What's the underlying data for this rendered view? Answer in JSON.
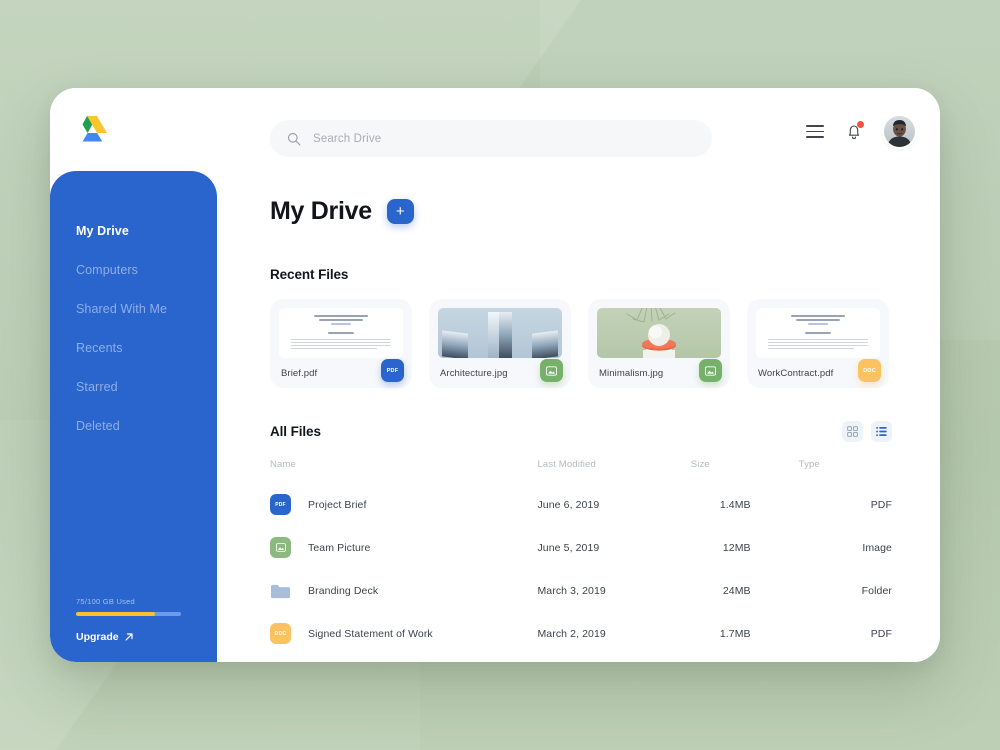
{
  "colors": {
    "page_background": "#b9ccb3",
    "sidebar": "#2a64cd",
    "accent": "#2a64cd",
    "storage_fill": "#fbc02d",
    "storage_track": "#6c9bec",
    "badge_pdf": "#2a64cd",
    "badge_image": "#76b06a",
    "badge_doc": "#fbc262",
    "notification_dot": "#f4513a"
  },
  "topbar": {
    "logo": "google-drive-logo",
    "search": {
      "placeholder": "Search Drive",
      "value": ""
    },
    "menu_icon": "hamburger-menu-icon",
    "bell_icon": "notification-bell-icon",
    "avatar": "user-avatar"
  },
  "sidebar": {
    "items": [
      {
        "label": "My Drive",
        "active": true
      },
      {
        "label": "Computers",
        "active": false
      },
      {
        "label": "Shared With Me",
        "active": false
      },
      {
        "label": "Recents",
        "active": false
      },
      {
        "label": "Starred",
        "active": false
      },
      {
        "label": "Deleted",
        "active": false
      }
    ],
    "storage": {
      "label": "75/100 GB Used",
      "percent": 75,
      "used_gb": 75,
      "total_gb": 100
    },
    "upgrade": {
      "label": "Upgrade",
      "icon": "arrow-up-right-icon"
    }
  },
  "main": {
    "page_title": "My Drive",
    "add_button": "+",
    "recent_section_title": "Recent Files",
    "recent_files": [
      {
        "name": "Brief.pdf",
        "badge": "PDF",
        "badge_type": "pdf",
        "thumb": "document-preview"
      },
      {
        "name": "Architecture.jpg",
        "badge": "image-icon",
        "badge_type": "img",
        "thumb": "architecture-photo"
      },
      {
        "name": "Minimalism.jpg",
        "badge": "image-icon",
        "badge_type": "img",
        "thumb": "minimalism-photo"
      },
      {
        "name": "WorkContract.pdf",
        "badge": "DOC",
        "badge_type": "doc",
        "thumb": "document-preview"
      }
    ],
    "all_files_section_title": "All Files",
    "view_toggle": {
      "grid": {
        "icon": "grid-view-icon",
        "active": false
      },
      "list": {
        "icon": "list-view-icon",
        "active": true
      }
    },
    "table": {
      "columns": [
        "Name",
        "Last Modified",
        "Size",
        "Type"
      ],
      "rows": [
        {
          "name": "Project Brief",
          "modified": "June 6, 2019",
          "size": "1.4MB",
          "type": "PDF",
          "icon": "pdf",
          "icon_label": "PDF"
        },
        {
          "name": "Team Picture",
          "modified": "June 5, 2019",
          "size": "12MB",
          "type": "Image",
          "icon": "img",
          "icon_label": ""
        },
        {
          "name": "Branding Deck",
          "modified": "March 3, 2019",
          "size": "24MB",
          "type": "Folder",
          "icon": "folder",
          "icon_label": ""
        },
        {
          "name": "Signed Statement of Work",
          "modified": "March 2, 2019",
          "size": "1.7MB",
          "type": "PDF",
          "icon": "doc",
          "icon_label": "DOC"
        }
      ]
    }
  }
}
